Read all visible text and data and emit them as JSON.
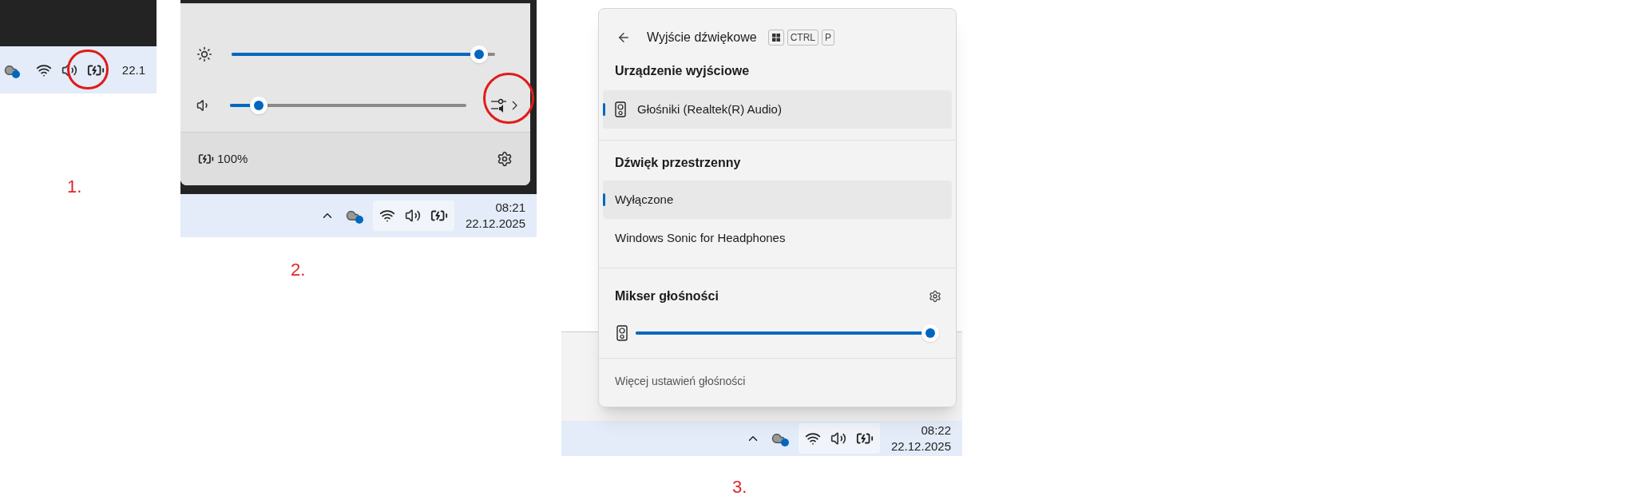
{
  "steps": [
    {
      "label": "1.",
      "taskbar": {
        "highlight_volume": true,
        "tray_hover": false,
        "clock": [
          "22.1"
        ]
      }
    },
    {
      "label": "2.",
      "quick_settings": {
        "sliders": [
          {
            "kind": "brightness",
            "level": 0.97
          },
          {
            "kind": "volume",
            "level": 0.09
          }
        ],
        "highlight_mixer": true,
        "battery": "100%"
      },
      "taskbar": {
        "highlight_volume": false,
        "tray_hover": true,
        "clock": [
          "08:21",
          "22.12.2025"
        ]
      }
    },
    {
      "label": "3.",
      "flyout": {
        "title": "Wyjście dźwiękowe",
        "keys": [
          "CTRL",
          "P"
        ],
        "output_heading": "Urządzenie wyjściowe",
        "devices": [
          {
            "label": "Głośniki (Realtek(R) Audio)",
            "selected": true
          }
        ],
        "spatial_heading": "Dźwięk przestrzenny",
        "spatial": [
          {
            "label": "Wyłączone",
            "selected": true
          },
          {
            "label": "Windows Sonic for Headphones",
            "selected": false
          }
        ],
        "mixer": {
          "heading": "Mikser głośności",
          "level": 1
        },
        "footer": "Więcej ustawień głośności"
      },
      "taskbar": {
        "highlight_volume": false,
        "tray_hover": true,
        "clock": [
          "08:22",
          "22.12.2025"
        ]
      }
    }
  ]
}
